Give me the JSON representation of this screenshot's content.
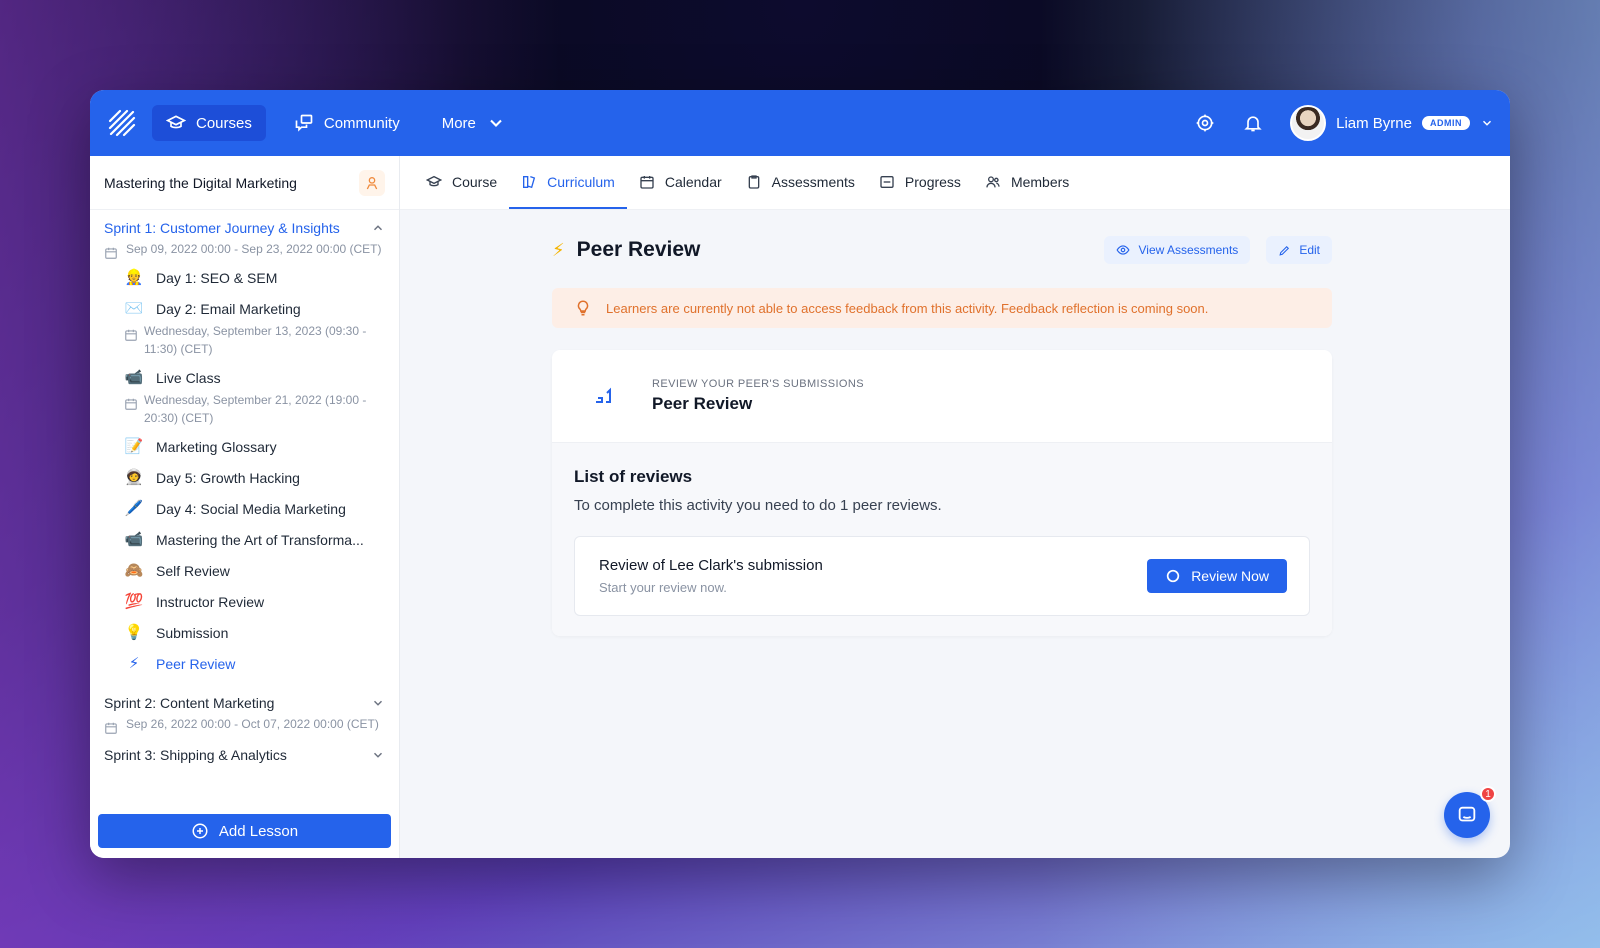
{
  "topbar": {
    "nav": [
      {
        "label": "Courses",
        "icon": "graduation-cap-icon",
        "active": true
      },
      {
        "label": "Community",
        "icon": "chat-bubbles-icon",
        "active": false
      },
      {
        "label": "More",
        "icon": "chevron-down-icon",
        "active": false
      }
    ],
    "user": {
      "name": "Liam Byrne",
      "role_badge": "ADMIN"
    }
  },
  "sidebar": {
    "course_title": "Mastering the Digital Marketing",
    "sprints": [
      {
        "title": "Sprint 1: Customer Journey & Insights",
        "date": "Sep 09, 2022 00:00 - Sep 23, 2022 00:00 (CET)",
        "open": true,
        "lessons": [
          {
            "emoji": "👷",
            "label": "Day 1: SEO & SEM"
          },
          {
            "emoji": "✉️",
            "label": "Day 2: Email Marketing",
            "sub": "Wednesday, September 13, 2023 (09:30 - 11:30) (CET)"
          },
          {
            "emoji": "📹",
            "label": "Live Class",
            "sub": "Wednesday, September 21, 2022 (19:00 - 20:30) (CET)"
          },
          {
            "emoji": "📝",
            "label": "Marketing Glossary"
          },
          {
            "emoji": "🧑‍🚀",
            "label": "Day 5: Growth Hacking"
          },
          {
            "emoji": "🖊️",
            "label": "Day 4: Social Media Marketing"
          },
          {
            "emoji": "📹",
            "label": "Mastering the Art of Transforma..."
          },
          {
            "emoji": "🙈",
            "label": "Self Review"
          },
          {
            "emoji": "💯",
            "label": "Instructor Review"
          },
          {
            "emoji": "💡",
            "label": "Submission"
          },
          {
            "emoji": "⚡",
            "label": "Peer Review",
            "active": true
          }
        ]
      },
      {
        "title": "Sprint 2: Content Marketing",
        "date": "Sep 26, 2022 00:00 - Oct 07, 2022 00:00 (CET)",
        "open": false
      },
      {
        "title": "Sprint 3: Shipping & Analytics",
        "open": false
      }
    ],
    "add_lesson_label": "Add Lesson"
  },
  "tabs": [
    {
      "label": "Course",
      "active": false
    },
    {
      "label": "Curriculum",
      "active": true
    },
    {
      "label": "Calendar",
      "active": false
    },
    {
      "label": "Assessments",
      "active": false
    },
    {
      "label": "Progress",
      "active": false
    },
    {
      "label": "Members",
      "active": false
    }
  ],
  "main": {
    "title": "Peer Review",
    "view_assessments_label": "View Assessments",
    "edit_label": "Edit",
    "warning": "Learners are currently not able to access feedback from this activity. Feedback reflection is coming soon.",
    "card": {
      "kicker": "REVIEW YOUR PEER'S SUBMISSIONS",
      "title": "Peer Review",
      "list_title": "List of reviews",
      "list_desc": "To complete this activity you need to do 1 peer reviews.",
      "review": {
        "title": "Review of Lee Clark's submission",
        "subtitle": "Start your review now.",
        "button": "Review Now"
      }
    },
    "chat_unread": "1"
  },
  "colors": {
    "brand": "#2563eb",
    "warning_text": "#e0712c",
    "warning_bg": "#fdeee6"
  }
}
